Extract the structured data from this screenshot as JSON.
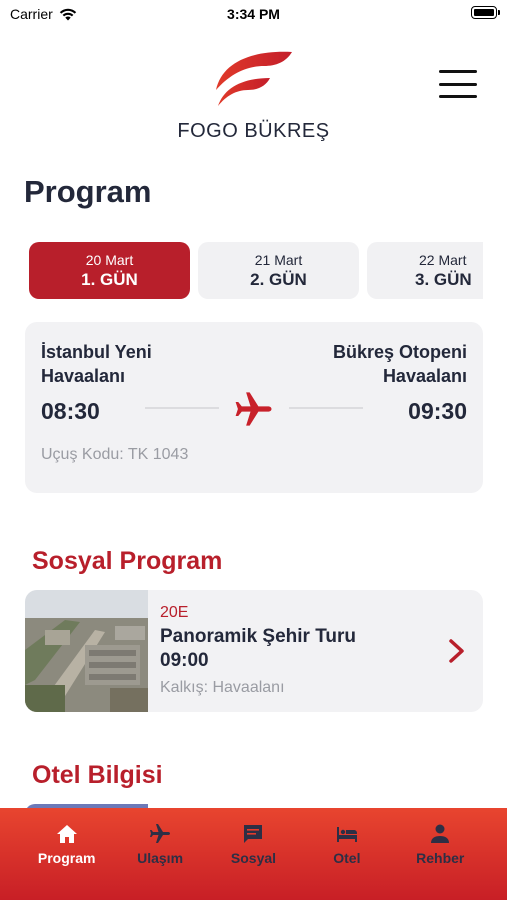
{
  "status_bar": {
    "carrier": "Carrier",
    "time": "3:34 PM"
  },
  "header": {
    "brand": "FOGO BÜKREŞ"
  },
  "page": {
    "title": "Program"
  },
  "days": [
    {
      "date": "20 Mart",
      "label": "1. GÜN",
      "active": true
    },
    {
      "date": "21 Mart",
      "label": "2. GÜN",
      "active": false
    },
    {
      "date": "22 Mart",
      "label": "3. GÜN",
      "active": false
    }
  ],
  "flight": {
    "from_line1": "İstanbul Yeni",
    "from_line2": "Havaalanı",
    "to_line1": "Bükreş Otopeni",
    "to_line2": "Havaalanı",
    "depart_time": "08:30",
    "arrive_time": "09:30",
    "code": "Uçuş Kodu: TK 1043"
  },
  "social": {
    "title": "Sosyal Program",
    "item": {
      "tag": "20E",
      "name": "Panoramik Şehir Turu",
      "time": "09:00",
      "departure": "Kalkış: Havaalanı"
    }
  },
  "hotel": {
    "title": "Otel Bilgisi"
  },
  "tabbar": [
    {
      "label": "Program",
      "icon": "home-icon",
      "active": true
    },
    {
      "label": "Ulaşım",
      "icon": "airplane-icon",
      "active": false
    },
    {
      "label": "Sosyal",
      "icon": "chat-icon",
      "active": false
    },
    {
      "label": "Otel",
      "icon": "bed-icon",
      "active": false
    },
    {
      "label": "Rehber",
      "icon": "person-icon",
      "active": false
    }
  ],
  "colors": {
    "accent": "#b81f2b",
    "tabbar_top": "#e8452f",
    "tabbar_bottom": "#c81f26",
    "card": "#f2f2f4"
  }
}
